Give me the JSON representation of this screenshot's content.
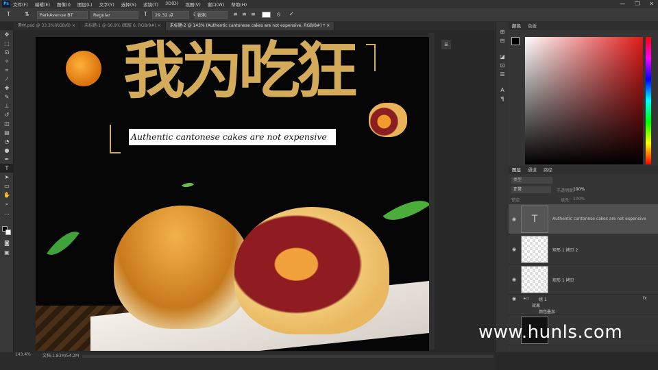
{
  "menubar": {
    "logo": "Ps",
    "items": [
      "文件(F)",
      "编辑(E)",
      "图像(I)",
      "图层(L)",
      "文字(Y)",
      "选择(S)",
      "滤镜(T)",
      "3D(D)",
      "视图(V)",
      "窗口(W)",
      "帮助(H)"
    ],
    "minimize": "—",
    "restore": "❐",
    "close": "✕"
  },
  "options": {
    "font_family": "ParkAvenue BT",
    "font_style": "Regular",
    "font_size": "29.32 点",
    "aa_mode": "锐利"
  },
  "tabs": [
    {
      "label": "素材.psd @ 33.3%(RGB/8)",
      "close": "×"
    },
    {
      "label": "未标题-1 @ 66.9% (图层 6, RGB/8#)",
      "close": "×"
    },
    {
      "label": "未标题-2 @ 143% (Authentic cantonese cakes are not expensive, RGB/8#) *",
      "close": "×"
    }
  ],
  "canvas": {
    "headline": "我为吃狂",
    "english_line": "Authentic cantonese cakes are not expensive"
  },
  "status": {
    "zoom": "143.4%",
    "doc_size": "文档:1.83M/54.2M"
  },
  "color_panel": {
    "tabs": [
      "颜色",
      "色板"
    ],
    "colors": {
      "foreground": "#000000",
      "background": "#ffffff"
    }
  },
  "layers_panel": {
    "tabs": [
      "图层",
      "通道",
      "路径"
    ],
    "kind_filter": "类型",
    "blend_mode": "正常",
    "opacity_label": "不透明度:",
    "opacity_value": "100%",
    "lock_label": "锁定:",
    "fill_label": "填充:",
    "fill_value": "100%",
    "layers": [
      {
        "name": "Authentic cantonese cakes are not expensive",
        "thumb": "T"
      },
      {
        "name": "矩形 1 拷贝 2"
      },
      {
        "name": "矩形 1 拷贝"
      }
    ],
    "group": {
      "name": "组 1",
      "fx": "fx",
      "effects_label": "效果",
      "effect": "颜色叠加"
    }
  },
  "watermark": "www.hunls.com"
}
